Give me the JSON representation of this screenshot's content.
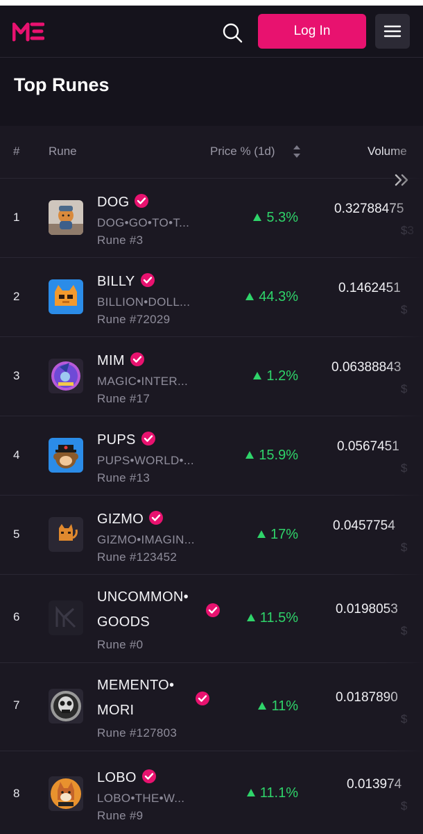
{
  "header": {
    "login_label": "Log In"
  },
  "page": {
    "title": "Top Runes"
  },
  "table": {
    "columns": {
      "rank": "#",
      "rune": "Rune",
      "price_change": "Price % (1d)",
      "volume": "Volume"
    },
    "rows": [
      {
        "rank": "1",
        "name": "DOG",
        "symbol": "DOG•GO•TO•T...",
        "rune_no": "Rune #3",
        "change": "5.3%",
        "volume": "0.32788475",
        "usd": "$3"
      },
      {
        "rank": "2",
        "name": "BILLY",
        "symbol": "BILLION•DOLL...",
        "rune_no": "Rune #72029",
        "change": "44.3%",
        "volume": "0.1462451",
        "usd": "$"
      },
      {
        "rank": "3",
        "name": "MIM",
        "symbol": "MAGIC•INTER...",
        "rune_no": "Rune #17",
        "change": "1.2%",
        "volume": "0.06388843",
        "usd": "$"
      },
      {
        "rank": "4",
        "name": "PUPS",
        "symbol": "PUPS•WORLD•...",
        "rune_no": "Rune #13",
        "change": "15.9%",
        "volume": "0.0567451",
        "usd": "$"
      },
      {
        "rank": "5",
        "name": "GIZMO",
        "symbol": "GIZMO•IMAGIN...",
        "rune_no": "Rune #123452",
        "change": "17%",
        "volume": "0.0457754",
        "usd": "$"
      },
      {
        "rank": "6",
        "name_line1": "UNCOMMON•",
        "name_line2": "GOODS",
        "rune_no": "Rune #0",
        "change": "11.5%",
        "volume": "0.0198053",
        "usd": "$"
      },
      {
        "rank": "7",
        "name_line1": "MEMENTO•",
        "name_line2": "MORI",
        "rune_no": "Rune #127803",
        "change": "11%",
        "volume": "0.0187890",
        "usd": "$"
      },
      {
        "rank": "8",
        "name": "LOBO",
        "symbol": "LOBO•THE•W...",
        "rune_no": "Rune #9",
        "change": "11.1%",
        "volume": "0.013974",
        "usd": "$"
      }
    ]
  },
  "colors": {
    "accent": "#e8126f",
    "positive": "#2fd46a",
    "background": "#15131c"
  },
  "icons": [
    "magic-eden-logo-icon",
    "search-icon",
    "hamburger-menu-icon",
    "sort-icon",
    "double-chevron-right-icon",
    "verified-badge-icon"
  ]
}
